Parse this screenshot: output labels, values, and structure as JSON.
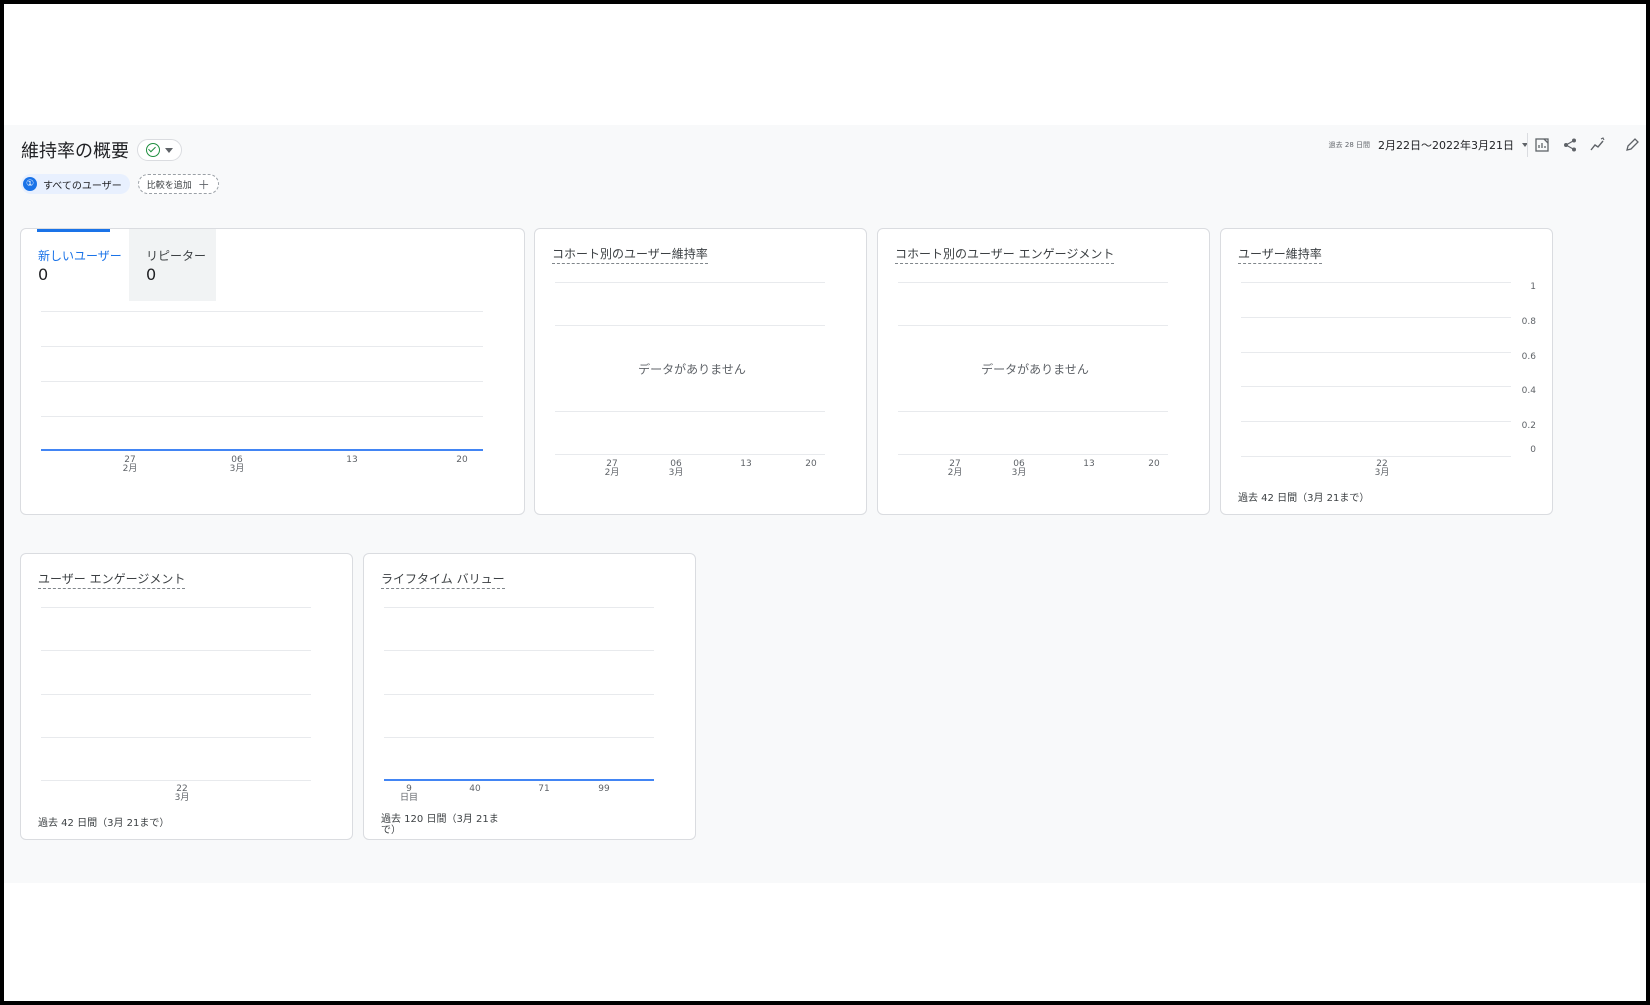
{
  "header": {
    "title": "維持率の概要",
    "date_small": "過去 28 日間",
    "date_range": "2月22日～2022年3月21日"
  },
  "segments": {
    "segment_number": "①",
    "segment_label": "すべてのユーザー",
    "add_compare": "比較を追加",
    "add_icon": "＋"
  },
  "cards": {
    "users": {
      "tabs": [
        {
          "label": "新しいユーザー",
          "value": "0"
        },
        {
          "label": "リピーター",
          "value": "0"
        }
      ],
      "ticks": [
        {
          "d": "27",
          "m": "2月"
        },
        {
          "d": "06",
          "m": "3月"
        },
        {
          "d": "13",
          "m": ""
        },
        {
          "d": "20",
          "m": ""
        }
      ]
    },
    "cohort_retention": {
      "title": "コホート別のユーザー維持率",
      "nodata": "データがありません",
      "ticks": [
        {
          "d": "27",
          "m": "2月"
        },
        {
          "d": "06",
          "m": "3月"
        },
        {
          "d": "13",
          "m": ""
        },
        {
          "d": "20",
          "m": ""
        }
      ]
    },
    "cohort_engagement": {
      "title": "コホート別のユーザー エンゲージメント",
      "nodata": "データがありません",
      "ticks": [
        {
          "d": "27",
          "m": "2月"
        },
        {
          "d": "06",
          "m": "3月"
        },
        {
          "d": "13",
          "m": ""
        },
        {
          "d": "20",
          "m": ""
        }
      ]
    },
    "user_retention": {
      "title": "ユーザー維持率",
      "yticks": [
        "1",
        "0.8",
        "0.6",
        "0.4",
        "0.2",
        "0"
      ],
      "xtick": {
        "d": "22",
        "m": "3月"
      },
      "footer": "過去 42 日間（3月 21まで）"
    },
    "user_engagement": {
      "title": "ユーザー エンゲージメント",
      "xtick": {
        "d": "22",
        "m": "3月"
      },
      "footer": "過去 42 日間（3月 21まで）"
    },
    "ltv": {
      "title": "ライフタイム バリュー",
      "ticks": [
        {
          "d": "9",
          "m": "日目"
        },
        {
          "d": "40",
          "m": ""
        },
        {
          "d": "71",
          "m": ""
        },
        {
          "d": "99",
          "m": ""
        }
      ],
      "footer_line1": "過去 120 日間（3月 21ま",
      "footer_line2": "で）"
    }
  },
  "icons": [
    "check-icon",
    "caret-down-icon",
    "customize-report-icon",
    "share-icon",
    "insights-icon",
    "edit-icon"
  ],
  "colors": {
    "accent": "#1a73e8",
    "line": "#4285f4",
    "background": "#f8f9fa"
  }
}
